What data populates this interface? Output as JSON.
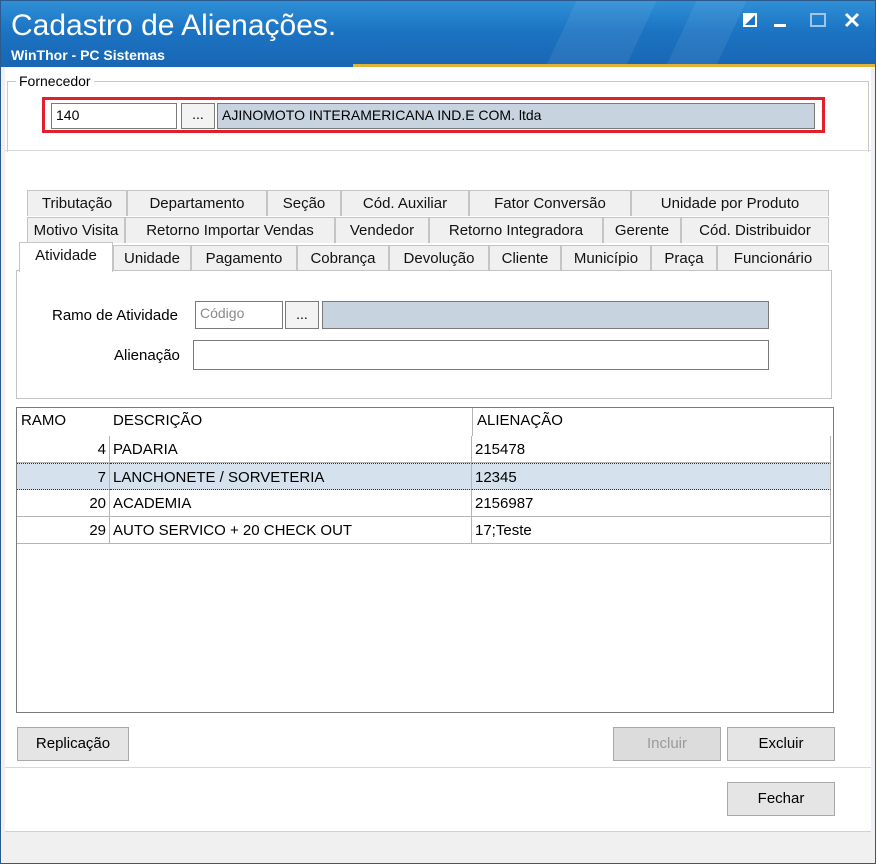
{
  "window": {
    "title": "Cadastro de Alienações.",
    "subtitle": "WinThor - PC Sistemas"
  },
  "fornecedor": {
    "legend": "Fornecedor",
    "code": "140",
    "browse": "...",
    "name": "AJINOMOTO INTERAMERICANA IND.E COM. ltda"
  },
  "tabs": {
    "row1": [
      "Tributação",
      "Departamento",
      "Seção",
      "Cód. Auxiliar",
      "Fator Conversão",
      "Unidade por Produto"
    ],
    "row2": [
      "Motivo Visita",
      "Retorno Importar Vendas",
      "Vendedor",
      "Retorno Integradora",
      "Gerente",
      "Cód. Distribuidor"
    ],
    "row3": [
      "Atividade",
      "Unidade",
      "Pagamento",
      "Cobrança",
      "Devolução",
      "Cliente",
      "Município",
      "Praça",
      "Funcionário"
    ],
    "active": "Atividade"
  },
  "form": {
    "ramo_label": "Ramo de Atividade",
    "ramo_placeholder": "Código",
    "ramo_browse": "...",
    "ramo_desc": "",
    "alienacao_label": "Alienação",
    "alienacao_value": ""
  },
  "grid": {
    "headers": [
      "RAMO",
      "DESCRIÇÃO",
      "ALIENAÇÃO"
    ],
    "rows": [
      {
        "ramo": "4",
        "descricao": "PADARIA",
        "alienacao": "215478"
      },
      {
        "ramo": "7",
        "descricao": "LANCHONETE / SORVETERIA",
        "alienacao": "12345"
      },
      {
        "ramo": "20",
        "descricao": "ACADEMIA",
        "alienacao": "2156987"
      },
      {
        "ramo": "29",
        "descricao": "AUTO SERVICO + 20 CHECK OUT",
        "alienacao": "17;Teste"
      }
    ],
    "selected_row": 1
  },
  "buttons": {
    "replicacao": "Replicação",
    "incluir": "Incluir",
    "excluir": "Excluir",
    "fechar": "Fechar"
  },
  "colors": {
    "titlebar": "#1c74c3",
    "highlight_border": "#e0202a",
    "readonly_field": "#c7d4e0",
    "selected_row": "#d5e2ee"
  }
}
